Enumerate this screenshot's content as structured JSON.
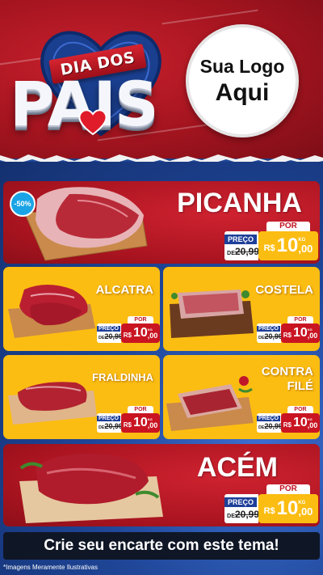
{
  "colors": {
    "header_red": "#a3141f",
    "card_red": "#aa1420",
    "card_yellow": "#fcbd12",
    "background_blue": "#1f4698",
    "price_label_blue": "#1e3f99",
    "badge_blue": "#1aa4e6",
    "banner_dark": "#0f1625"
  },
  "header": {
    "ribbon_text": "DIA DOS",
    "title_text": "PAIS",
    "logo_line1": "Sua Logo",
    "logo_line2": "Aqui"
  },
  "products": {
    "picanha": {
      "name": "PICANHA",
      "badge": "-50%",
      "price_label": "PREÇO",
      "old_prefix": "DE",
      "old_price": "20,99",
      "por_label": "POR",
      "currency": "R$",
      "price_int": "10",
      "price_cents": ",00",
      "unit": "KG"
    },
    "alcatra": {
      "name": "ALCATRA",
      "price_label": "PREÇO",
      "old_prefix": "DE",
      "old_price": "20,99",
      "por_label": "POR",
      "currency": "R$",
      "price_int": "10",
      "price_cents": ",00",
      "unit": "KG"
    },
    "costela": {
      "name": "COSTELA",
      "price_label": "PREÇO",
      "old_prefix": "DE",
      "old_price": "20,99",
      "por_label": "POR",
      "currency": "R$",
      "price_int": "10",
      "price_cents": ",00",
      "unit": "KG"
    },
    "fraldinha": {
      "name": "FRALDINHA",
      "price_label": "PREÇO",
      "old_prefix": "DE",
      "old_price": "20,99",
      "por_label": "POR",
      "currency": "R$",
      "price_int": "10",
      "price_cents": ",00",
      "unit": "KG"
    },
    "contra_file": {
      "name_line1": "CONTRA",
      "name_line2": "FILÉ",
      "price_label": "PREÇO",
      "old_prefix": "DE",
      "old_price": "20,99",
      "por_label": "POR",
      "currency": "R$",
      "price_int": "10",
      "price_cents": ",00",
      "unit": "KG"
    },
    "acem": {
      "name": "ACÉM",
      "price_label": "PREÇO",
      "old_prefix": "DE",
      "old_price": "20,99",
      "por_label": "POR",
      "currency": "R$",
      "price_int": "10",
      "price_cents": ",00",
      "unit": "KG"
    }
  },
  "banner": {
    "text": "Crie seu encarte com este tema!"
  },
  "footnote": "*Imagens Meramente Ilustrativas",
  "icons": [
    "heart-icon",
    "meat-board-image"
  ]
}
